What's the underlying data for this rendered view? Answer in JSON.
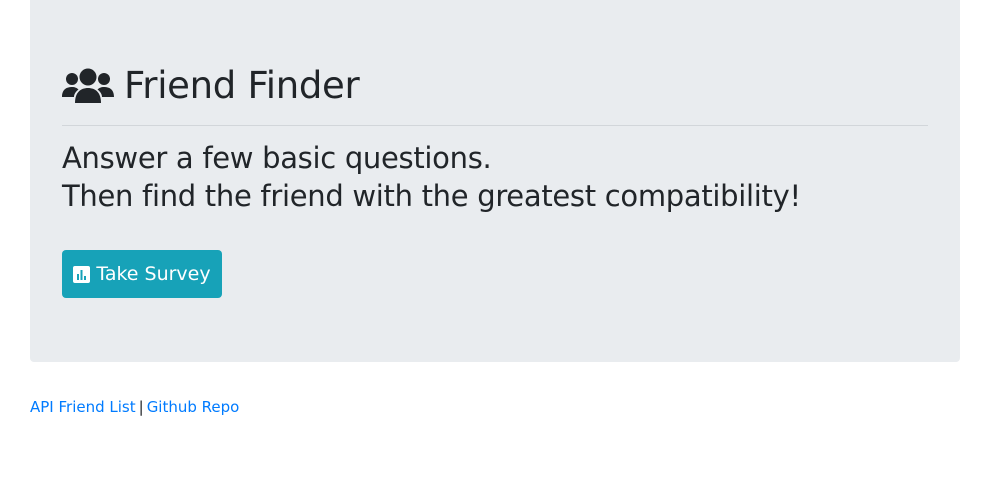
{
  "header": {
    "icon": "users-icon",
    "title": "Friend Finder"
  },
  "lead": {
    "line1": "Answer a few basic questions.",
    "line2": "Then find the friend with the greatest compatibility!"
  },
  "survey_button": {
    "icon": "bar-chart-icon",
    "label": "Take Survey",
    "color": "#17a2b8"
  },
  "footer": {
    "api_link": "API Friend List",
    "separator": "|",
    "github_link": "Github Repo",
    "link_color": "#007bff"
  },
  "colors": {
    "jumbotron_bg": "#e9ecef",
    "text": "#212529"
  }
}
